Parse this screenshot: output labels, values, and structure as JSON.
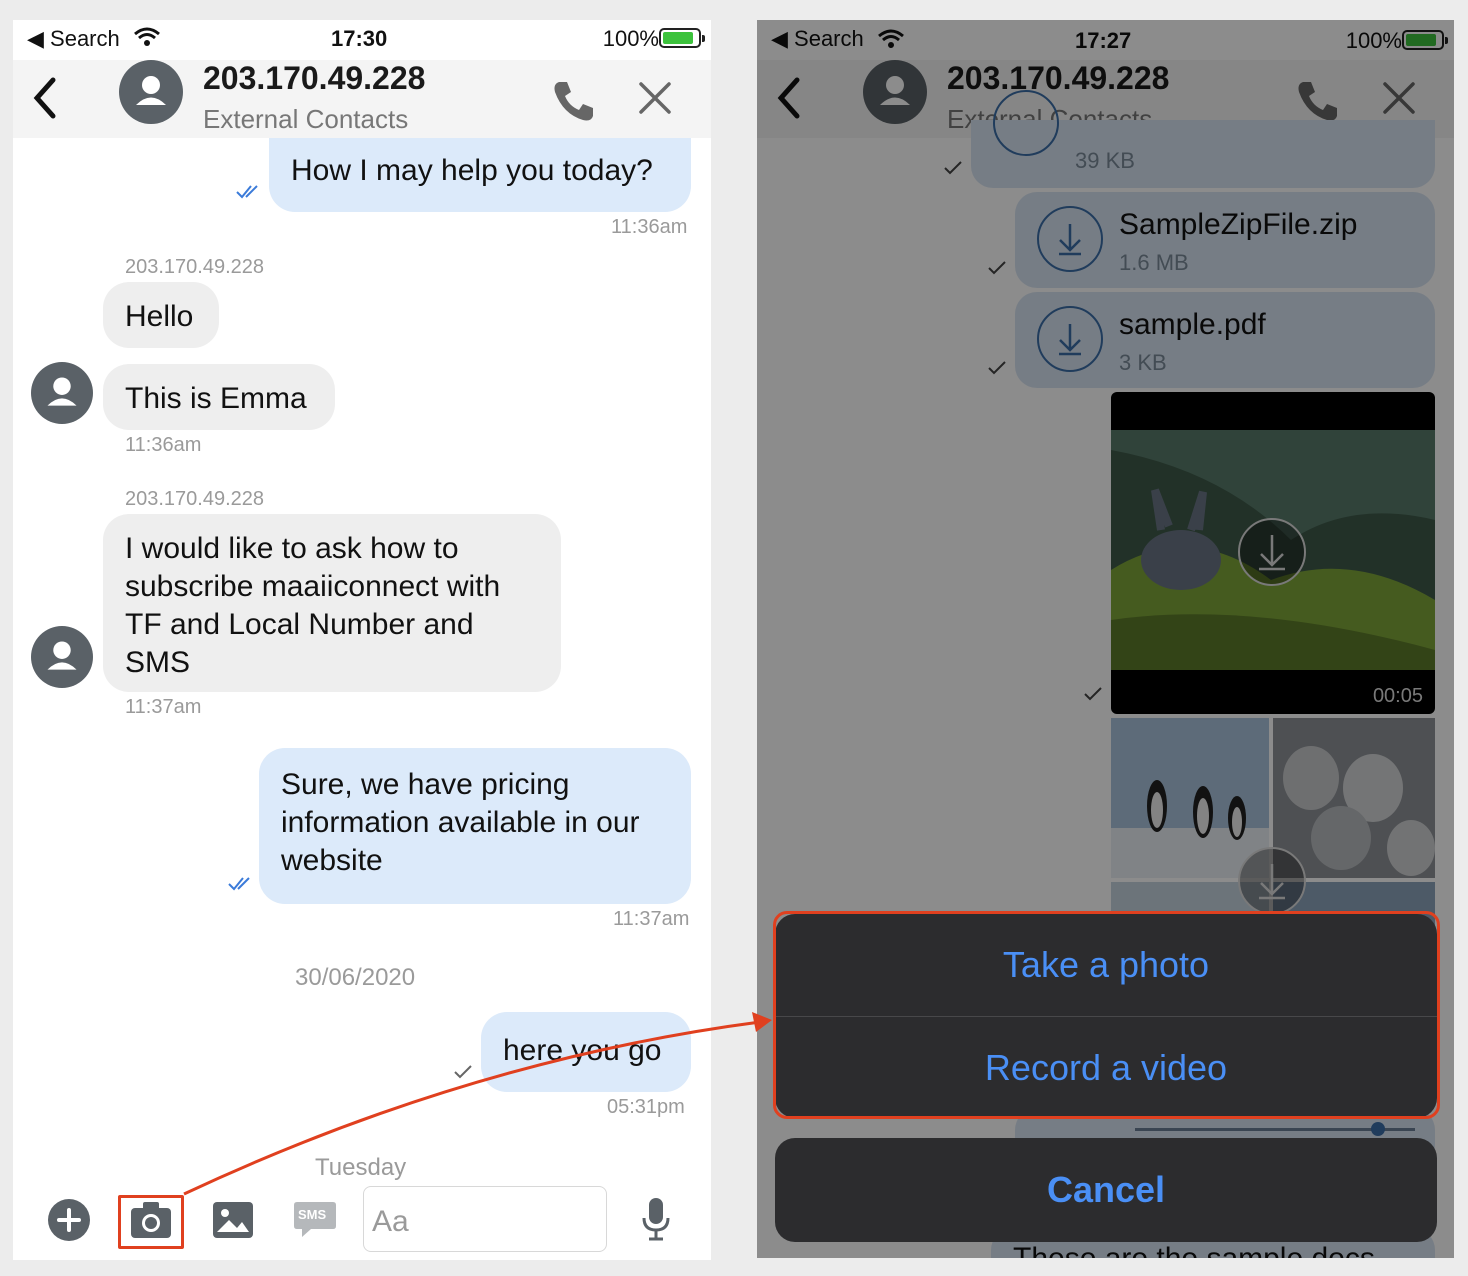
{
  "left_screen": {
    "status": {
      "carrier": "Search",
      "time": "17:30",
      "battery": "100%"
    },
    "header": {
      "title": "203.170.49.228",
      "subtitle": "External Contacts"
    },
    "messages": [
      {
        "dir": "out",
        "text": "How I may help you today?",
        "time": "11:36am"
      },
      {
        "dir": "in",
        "sender": "203.170.49.228",
        "texts": [
          "Hello",
          "This is Emma"
        ],
        "time": "11:36am"
      },
      {
        "dir": "in",
        "sender": "203.170.49.228",
        "lines": [
          "I would like to ask how to",
          "subscribe maaiiconnect with",
          "TF and Local Number and",
          "SMS"
        ],
        "time": "11:37am"
      },
      {
        "dir": "out",
        "lines": [
          "Sure, we have pricing",
          "information available in our",
          "website"
        ],
        "time": "11:37am"
      },
      {
        "date": "30/06/2020"
      },
      {
        "dir": "out",
        "text": "here you go",
        "time": "05:31pm"
      },
      {
        "date": "Tuesday"
      }
    ],
    "composer": {
      "placeholder": "Aa",
      "sms_label": "SMS"
    }
  },
  "right_screen": {
    "status": {
      "carrier": "Search",
      "time": "17:27",
      "battery": "100%"
    },
    "header": {
      "title": "203.170.49.228",
      "subtitle": "External Contacts"
    },
    "files": [
      {
        "name": "",
        "size": "39 KB"
      },
      {
        "name": "SampleZipFile.zip",
        "size": "1.6 MB"
      },
      {
        "name": "sample.pdf",
        "size": "3 KB"
      }
    ],
    "video": {
      "duration": "00:05"
    },
    "action_sheet": {
      "take_photo": "Take a photo",
      "record_video": "Record a video",
      "cancel": "Cancel"
    },
    "partial_text": "These are the sample docs"
  },
  "colors": {
    "bubble_out": "#dceafa",
    "bubble_in": "#eeeeee",
    "accent": "#4a8ff5",
    "highlight": "#e0401f"
  }
}
